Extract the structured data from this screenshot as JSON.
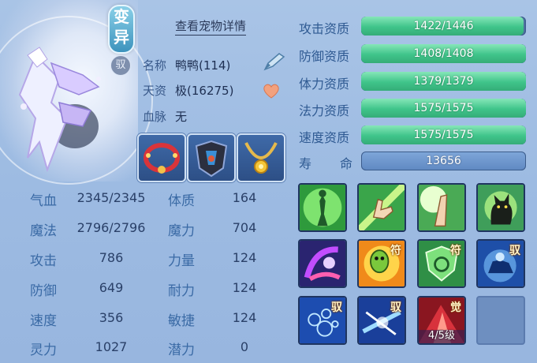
{
  "header": {
    "bian_yi": "变异",
    "yu": "驭",
    "view_detail": "查看宠物详情"
  },
  "info": {
    "name_label": "名称",
    "name_value": "鸭鸭(114)",
    "talent_label": "天资",
    "talent_value": "极(16275)",
    "bloodline_label": "血脉",
    "bloodline_value": "无"
  },
  "aptitudes": [
    {
      "label": "攻击资质",
      "text": "1422/1446",
      "current": 1422,
      "max": 1446
    },
    {
      "label": "防御资质",
      "text": "1408/1408",
      "current": 1408,
      "max": 1408
    },
    {
      "label": "体力资质",
      "text": "1379/1379",
      "current": 1379,
      "max": 1379
    },
    {
      "label": "法力资质",
      "text": "1575/1575",
      "current": 1575,
      "max": 1575
    },
    {
      "label": "速度资质",
      "text": "1575/1575",
      "current": 1575,
      "max": 1575
    }
  ],
  "life": {
    "label1": "寿",
    "label2": "命",
    "value": "13656"
  },
  "stats_left": [
    {
      "label": "气血",
      "value": "2345/2345"
    },
    {
      "label": "魔法",
      "value": "2796/2796"
    },
    {
      "label": "攻击",
      "value": "786"
    },
    {
      "label": "防御",
      "value": "649"
    },
    {
      "label": "速度",
      "value": "356"
    },
    {
      "label": "灵力",
      "value": "1027"
    }
  ],
  "stats_right": [
    {
      "label": "体质",
      "value": "164"
    },
    {
      "label": "魔力",
      "value": "704"
    },
    {
      "label": "力量",
      "value": "124"
    },
    {
      "label": "耐力",
      "value": "124"
    },
    {
      "label": "敏捷",
      "value": "124"
    },
    {
      "label": "潜力",
      "value": "0"
    }
  ],
  "skills": [
    {
      "icon": "figure-glow-skill-icon",
      "tag": ""
    },
    {
      "icon": "hand-palm-skill-icon",
      "tag": ""
    },
    {
      "icon": "praying-hands-skill-icon",
      "tag": ""
    },
    {
      "icon": "black-cat-skill-icon",
      "tag": ""
    },
    {
      "icon": "purple-vortex-skill-icon",
      "tag": ""
    },
    {
      "icon": "green-mask-skill-icon",
      "tag": "符"
    },
    {
      "icon": "shield-swirl-skill-icon",
      "tag": "符"
    },
    {
      "icon": "blue-beast-orb-skill-icon",
      "tag": "驭"
    },
    {
      "icon": "blue-bubbles-skill-icon",
      "tag": "驭"
    },
    {
      "icon": "blue-strike-skill-icon",
      "tag": "驭"
    },
    {
      "icon": "red-awaken-skill-icon",
      "tag": "觉",
      "level": "4/5级"
    },
    {
      "icon": "empty-slot",
      "tag": ""
    }
  ],
  "colors": {
    "bar_green": "#3fc48a",
    "panel_blue": "#9dbbe2",
    "empty_slot": "#6e8fc0"
  }
}
